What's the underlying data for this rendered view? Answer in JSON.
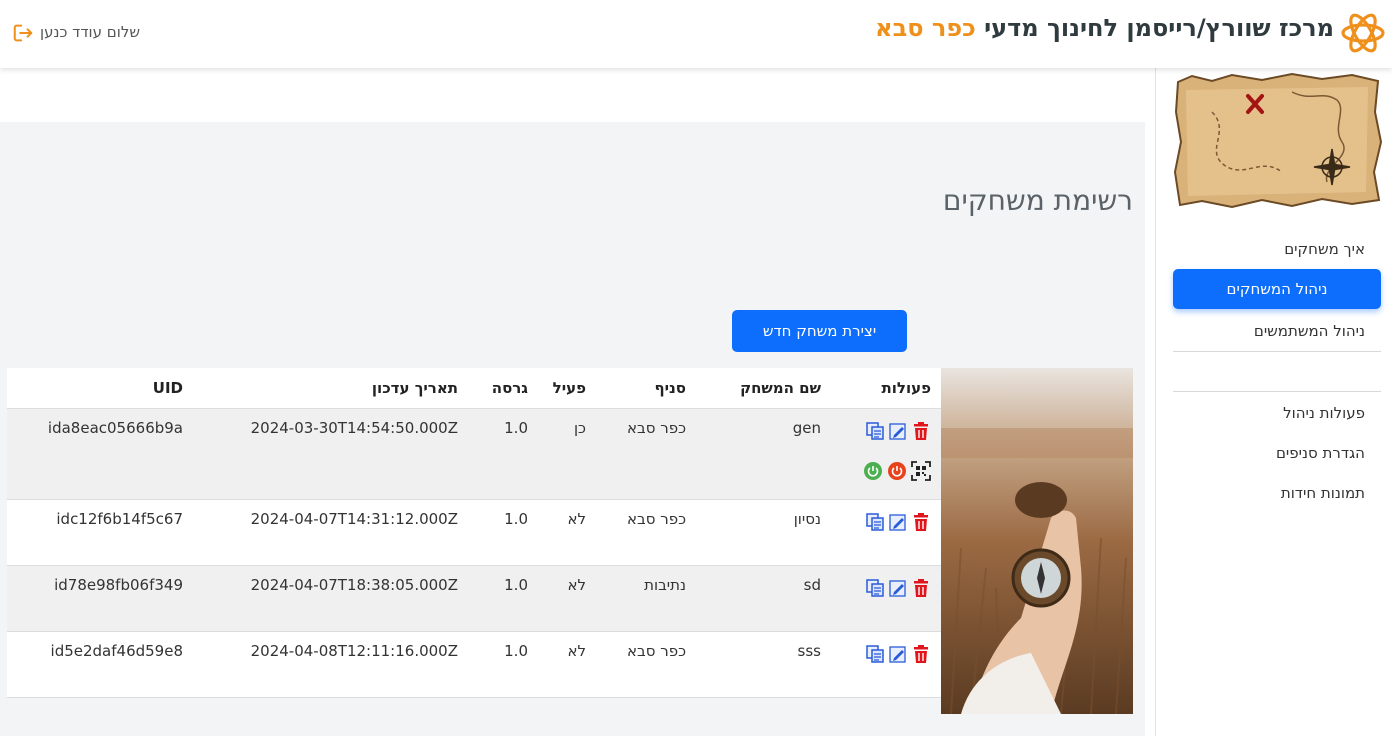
{
  "header": {
    "brand_main": "מרכז שוורץ/רייסמן לחינוך מדעי",
    "brand_city": "כפר סבא",
    "greeting": "שלום עודד כנען"
  },
  "sidebar": {
    "items_top": [
      {
        "label": "איך משחקים",
        "active": false
      },
      {
        "label": "ניהול המשחקים",
        "active": true
      },
      {
        "label": "ניהול המשתמשים",
        "active": false
      }
    ],
    "items_bottom": [
      {
        "label": "פעולות ניהול"
      },
      {
        "label": "הגדרת סניפים"
      },
      {
        "label": "תמונות חידות"
      }
    ]
  },
  "main": {
    "title": "רשימת משחקים",
    "create_button": "יצירת משחק חדש",
    "columns": [
      "פעולות",
      "שם המשחק",
      "סניף",
      "פעיל",
      "גרסה",
      "תאריך עדכון",
      "UID"
    ],
    "rows": [
      {
        "name": "gen",
        "branch": "כפר סבא",
        "active": "כן",
        "version": "1.0",
        "updated": "2024-03-30T14:54:50.000Z",
        "uid": "ida8eac05666b9a"
      },
      {
        "name": "נסיון",
        "branch": "כפר סבא",
        "active": "לא",
        "version": "1.0",
        "updated": "2024-04-07T14:31:12.000Z",
        "uid": "idc12f6b14f5c67"
      },
      {
        "name": "sd",
        "branch": "נתיבות",
        "active": "לא",
        "version": "1.0",
        "updated": "2024-04-07T18:38:05.000Z",
        "uid": "id78e98fb06f349"
      },
      {
        "name": "sss",
        "branch": "כפר סבא",
        "active": "לא",
        "version": "1.0",
        "updated": "2024-04-08T12:11:16.000Z",
        "uid": "id5e2daf46d59e8"
      }
    ]
  },
  "colors": {
    "accent": "#0d6efd",
    "brand_orange": "#f0901c",
    "delete_red": "#e0161c",
    "power_green": "#4caf50",
    "power_red": "#e8421c"
  },
  "icons": [
    "logo-icon",
    "logout-icon",
    "copy-icon",
    "edit-icon",
    "delete-icon",
    "qr-icon",
    "power-off-icon",
    "power-on-icon"
  ]
}
